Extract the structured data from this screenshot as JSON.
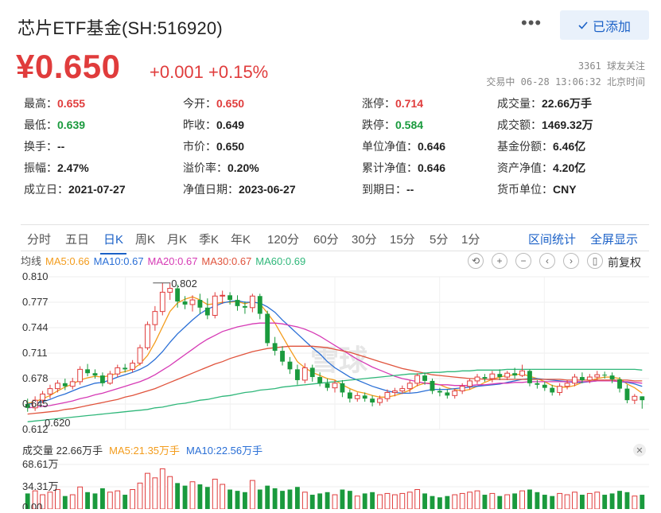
{
  "header": {
    "title": "芯片ETF基金(SH:516920)",
    "added_label": "已添加",
    "more_label": "•••"
  },
  "quote": {
    "price": "¥0.650",
    "change": "+0.001 +0.15%",
    "followers": "3361 球友关注",
    "status": "交易中 06-28 13:06:32 北京时间"
  },
  "stats": [
    [
      {
        "label": "最高：",
        "value": "0.655",
        "tone": "up"
      },
      {
        "label": "今开：",
        "value": "0.650",
        "tone": "up"
      },
      {
        "label": "涨停：",
        "value": "0.714",
        "tone": "up"
      },
      {
        "label": "成交量：",
        "value": "22.66万手",
        "tone": ""
      }
    ],
    [
      {
        "label": "最低：",
        "value": "0.639",
        "tone": "down"
      },
      {
        "label": "昨收：",
        "value": "0.649",
        "tone": ""
      },
      {
        "label": "跌停：",
        "value": "0.584",
        "tone": "down"
      },
      {
        "label": "成交额：",
        "value": "1469.32万",
        "tone": ""
      }
    ],
    [
      {
        "label": "换手：",
        "value": "--",
        "tone": ""
      },
      {
        "label": "市价：",
        "value": "0.650",
        "tone": ""
      },
      {
        "label": "单位净值：",
        "value": "0.646",
        "tone": ""
      },
      {
        "label": "基金份额：",
        "value": "6.46亿",
        "tone": ""
      }
    ],
    [
      {
        "label": "振幅：",
        "value": "2.47%",
        "tone": ""
      },
      {
        "label": "溢价率：",
        "value": "0.20%",
        "tone": ""
      },
      {
        "label": "累计净值：",
        "value": "0.646",
        "tone": ""
      },
      {
        "label": "资产净值：",
        "value": "4.20亿",
        "tone": ""
      }
    ],
    [
      {
        "label": "成立日：",
        "value": "2021-07-27",
        "tone": ""
      },
      {
        "label": "净值日期：",
        "value": "2023-06-27",
        "tone": ""
      },
      {
        "label": "到期日：",
        "value": "--",
        "tone": ""
      },
      {
        "label": "货币单位：",
        "value": "CNY",
        "tone": ""
      }
    ]
  ],
  "tabs": [
    "分时",
    "五日",
    "日K",
    "周K",
    "月K",
    "季K",
    "年K",
    "120分",
    "60分",
    "30分",
    "15分",
    "5分",
    "1分"
  ],
  "active_tab": "日K",
  "tab_links": [
    "区间统计",
    "全屏显示"
  ],
  "ma_legend": [
    {
      "label": "均线",
      "color": "#555555"
    },
    {
      "label": "MA5:0.66",
      "color": "#f39c1c"
    },
    {
      "label": "MA10:0.67",
      "color": "#2a6fd6"
    },
    {
      "label": "MA20:0.67",
      "color": "#d63ab5"
    },
    {
      "label": "MA30:0.67",
      "color": "#e0533c"
    },
    {
      "label": "MA60:0.69",
      "color": "#2fb77a"
    }
  ],
  "tool_icons": [
    "reset-icon",
    "zoom-in-icon",
    "zoom-out-icon",
    "pan-left-icon",
    "pan-right-icon",
    "candle-icon"
  ],
  "rehab_label": "前复权",
  "volume_legend": [
    {
      "label": "成交量 22.66万手",
      "color": "#333333"
    },
    {
      "label": "MA5:21.35万手",
      "color": "#f39c1c"
    },
    {
      "label": "MA10:22.56万手",
      "color": "#2a6fd6"
    }
  ],
  "watermark": "雪球",
  "colors": {
    "up": "#e03c3c",
    "down": "#1a9a3d",
    "accent": "#1b61c7"
  },
  "chart_data": {
    "type": "candlestick",
    "price_axis": {
      "ticks": [
        "0.810",
        "0.777",
        "0.744",
        "0.711",
        "0.678",
        "0.645",
        "0.612"
      ],
      "range": [
        0.612,
        0.81
      ]
    },
    "annotations": [
      {
        "label": "0.802"
      },
      {
        "label": "0.620"
      }
    ],
    "volume_axis": {
      "ticks": [
        "68.61万",
        "34.31万",
        "0.00"
      ],
      "range": [
        0,
        68.61
      ]
    },
    "candles": [
      [
        0.645,
        0.64,
        0.652,
        0.635
      ],
      [
        0.64,
        0.65,
        0.655,
        0.636
      ],
      [
        0.65,
        0.658,
        0.662,
        0.646
      ],
      [
        0.658,
        0.665,
        0.67,
        0.652
      ],
      [
        0.665,
        0.672,
        0.676,
        0.66
      ],
      [
        0.672,
        0.668,
        0.678,
        0.663
      ],
      [
        0.668,
        0.674,
        0.679,
        0.664
      ],
      [
        0.674,
        0.69,
        0.694,
        0.67
      ],
      [
        0.69,
        0.685,
        0.697,
        0.681
      ],
      [
        0.685,
        0.682,
        0.69,
        0.678
      ],
      [
        0.682,
        0.672,
        0.686,
        0.668
      ],
      [
        0.672,
        0.684,
        0.688,
        0.67
      ],
      [
        0.684,
        0.692,
        0.696,
        0.68
      ],
      [
        0.692,
        0.69,
        0.697,
        0.686
      ],
      [
        0.69,
        0.698,
        0.702,
        0.686
      ],
      [
        0.698,
        0.718,
        0.722,
        0.695
      ],
      [
        0.718,
        0.748,
        0.752,
        0.715
      ],
      [
        0.748,
        0.765,
        0.772,
        0.74
      ],
      [
        0.765,
        0.79,
        0.802,
        0.76
      ],
      [
        0.79,
        0.795,
        0.802,
        0.78
      ],
      [
        0.795,
        0.778,
        0.8,
        0.77
      ],
      [
        0.778,
        0.774,
        0.785,
        0.768
      ],
      [
        0.774,
        0.78,
        0.786,
        0.765
      ],
      [
        0.78,
        0.77,
        0.788,
        0.762
      ],
      [
        0.77,
        0.76,
        0.782,
        0.755
      ],
      [
        0.76,
        0.785,
        0.79,
        0.756
      ],
      [
        0.785,
        0.786,
        0.792,
        0.775
      ],
      [
        0.786,
        0.78,
        0.79,
        0.774
      ],
      [
        0.78,
        0.772,
        0.786,
        0.766
      ],
      [
        0.772,
        0.77,
        0.778,
        0.762
      ],
      [
        0.77,
        0.785,
        0.788,
        0.764
      ],
      [
        0.785,
        0.762,
        0.788,
        0.755
      ],
      [
        0.762,
        0.724,
        0.766,
        0.72
      ],
      [
        0.724,
        0.714,
        0.732,
        0.708
      ],
      [
        0.714,
        0.7,
        0.72,
        0.695
      ],
      [
        0.7,
        0.69,
        0.706,
        0.684
      ],
      [
        0.69,
        0.676,
        0.696,
        0.67
      ],
      [
        0.676,
        0.692,
        0.698,
        0.672
      ],
      [
        0.692,
        0.68,
        0.696,
        0.674
      ],
      [
        0.68,
        0.672,
        0.686,
        0.668
      ],
      [
        0.672,
        0.666,
        0.678,
        0.662
      ],
      [
        0.666,
        0.672,
        0.676,
        0.66
      ],
      [
        0.672,
        0.66,
        0.676,
        0.654
      ],
      [
        0.66,
        0.652,
        0.664,
        0.647
      ],
      [
        0.652,
        0.656,
        0.66,
        0.648
      ],
      [
        0.656,
        0.652,
        0.66,
        0.648
      ],
      [
        0.652,
        0.647,
        0.656,
        0.642
      ],
      [
        0.647,
        0.652,
        0.656,
        0.643
      ],
      [
        0.652,
        0.66,
        0.664,
        0.648
      ],
      [
        0.66,
        0.662,
        0.666,
        0.655
      ],
      [
        0.662,
        0.665,
        0.669,
        0.658
      ],
      [
        0.665,
        0.672,
        0.676,
        0.66
      ],
      [
        0.672,
        0.682,
        0.685,
        0.668
      ],
      [
        0.682,
        0.675,
        0.686,
        0.67
      ],
      [
        0.675,
        0.662,
        0.678,
        0.658
      ],
      [
        0.662,
        0.66,
        0.666,
        0.655
      ],
      [
        0.66,
        0.656,
        0.664,
        0.652
      ],
      [
        0.656,
        0.662,
        0.665,
        0.652
      ],
      [
        0.662,
        0.668,
        0.672,
        0.658
      ],
      [
        0.668,
        0.675,
        0.678,
        0.664
      ],
      [
        0.675,
        0.68,
        0.684,
        0.671
      ],
      [
        0.68,
        0.678,
        0.684,
        0.674
      ],
      [
        0.678,
        0.684,
        0.688,
        0.673
      ],
      [
        0.684,
        0.68,
        0.69,
        0.676
      ],
      [
        0.68,
        0.685,
        0.688,
        0.676
      ],
      [
        0.685,
        0.682,
        0.692,
        0.678
      ],
      [
        0.682,
        0.688,
        0.696,
        0.68
      ],
      [
        0.688,
        0.672,
        0.69,
        0.668
      ],
      [
        0.672,
        0.67,
        0.676,
        0.665
      ],
      [
        0.67,
        0.666,
        0.674,
        0.662
      ],
      [
        0.666,
        0.66,
        0.67,
        0.656
      ],
      [
        0.66,
        0.668,
        0.672,
        0.656
      ],
      [
        0.668,
        0.672,
        0.676,
        0.664
      ],
      [
        0.672,
        0.68,
        0.684,
        0.668
      ],
      [
        0.68,
        0.676,
        0.686,
        0.672
      ],
      [
        0.676,
        0.68,
        0.684,
        0.672
      ],
      [
        0.68,
        0.683,
        0.688,
        0.676
      ],
      [
        0.683,
        0.682,
        0.687,
        0.678
      ],
      [
        0.682,
        0.677,
        0.686,
        0.672
      ],
      [
        0.677,
        0.665,
        0.68,
        0.66
      ],
      [
        0.665,
        0.65,
        0.67,
        0.646
      ],
      [
        0.65,
        0.655,
        0.658,
        0.645
      ],
      [
        0.655,
        0.65,
        0.655,
        0.639
      ]
    ],
    "volume": [
      24,
      28,
      22,
      26,
      30,
      20,
      22,
      34,
      26,
      24,
      32,
      26,
      28,
      22,
      30,
      40,
      55,
      48,
      62,
      50,
      40,
      36,
      42,
      38,
      34,
      46,
      38,
      30,
      28,
      26,
      44,
      30,
      36,
      32,
      28,
      30,
      34,
      26,
      22,
      24,
      26,
      22,
      30,
      28,
      20,
      24,
      26,
      22,
      24,
      22,
      24,
      26,
      30,
      24,
      20,
      18,
      20,
      22,
      24,
      26,
      28,
      22,
      24,
      20,
      22,
      24,
      28,
      30,
      26,
      22,
      20,
      24,
      22,
      26,
      22,
      24,
      26,
      22,
      24,
      28,
      26,
      20,
      22
    ],
    "ma": {
      "MA5": [
        0.646,
        0.648,
        0.652,
        0.656,
        0.662,
        0.667,
        0.671,
        0.676,
        0.679,
        0.681,
        0.68,
        0.682,
        0.685,
        0.687,
        0.69,
        0.697,
        0.708,
        0.725,
        0.745,
        0.765,
        0.776,
        0.781,
        0.784,
        0.78,
        0.774,
        0.775,
        0.777,
        0.777,
        0.778,
        0.775,
        0.778,
        0.775,
        0.763,
        0.75,
        0.733,
        0.716,
        0.7,
        0.692,
        0.686,
        0.682,
        0.678,
        0.676,
        0.67,
        0.665,
        0.661,
        0.659,
        0.656,
        0.654,
        0.654,
        0.656,
        0.659,
        0.663,
        0.669,
        0.672,
        0.672,
        0.67,
        0.666,
        0.664,
        0.662,
        0.664,
        0.668,
        0.673,
        0.677,
        0.68,
        0.682,
        0.683,
        0.684,
        0.681,
        0.678,
        0.674,
        0.669,
        0.667,
        0.667,
        0.669,
        0.673,
        0.675,
        0.678,
        0.68,
        0.68,
        0.678,
        0.671,
        0.666,
        0.659
      ],
      "MA10": [
        0.645,
        0.646,
        0.648,
        0.651,
        0.655,
        0.658,
        0.662,
        0.666,
        0.669,
        0.672,
        0.673,
        0.676,
        0.68,
        0.683,
        0.686,
        0.69,
        0.695,
        0.703,
        0.713,
        0.725,
        0.736,
        0.745,
        0.754,
        0.762,
        0.768,
        0.772,
        0.776,
        0.778,
        0.779,
        0.777,
        0.777,
        0.776,
        0.771,
        0.764,
        0.754,
        0.745,
        0.736,
        0.727,
        0.718,
        0.71,
        0.7,
        0.692,
        0.686,
        0.68,
        0.676,
        0.672,
        0.668,
        0.665,
        0.662,
        0.66,
        0.659,
        0.659,
        0.66,
        0.662,
        0.664,
        0.664,
        0.664,
        0.665,
        0.666,
        0.667,
        0.668,
        0.669,
        0.67,
        0.671,
        0.673,
        0.675,
        0.677,
        0.678,
        0.678,
        0.677,
        0.676,
        0.675,
        0.674,
        0.673,
        0.673,
        0.674,
        0.675,
        0.675,
        0.675,
        0.674,
        0.673,
        0.671,
        0.668
      ],
      "MA20": [
        0.64,
        0.641,
        0.642,
        0.643,
        0.645,
        0.647,
        0.649,
        0.652,
        0.654,
        0.657,
        0.659,
        0.662,
        0.665,
        0.668,
        0.671,
        0.674,
        0.678,
        0.683,
        0.689,
        0.695,
        0.702,
        0.709,
        0.716,
        0.723,
        0.729,
        0.734,
        0.739,
        0.742,
        0.745,
        0.747,
        0.749,
        0.75,
        0.75,
        0.75,
        0.749,
        0.747,
        0.745,
        0.742,
        0.738,
        0.733,
        0.727,
        0.721,
        0.715,
        0.709,
        0.703,
        0.698,
        0.693,
        0.689,
        0.685,
        0.681,
        0.678,
        0.676,
        0.674,
        0.672,
        0.671,
        0.67,
        0.67,
        0.669,
        0.669,
        0.669,
        0.67,
        0.67,
        0.671,
        0.672,
        0.672,
        0.673,
        0.673,
        0.674,
        0.674,
        0.674,
        0.674,
        0.674,
        0.674,
        0.674,
        0.674,
        0.674,
        0.675,
        0.675,
        0.675,
        0.674,
        0.674,
        0.673,
        0.672
      ],
      "MA30": [
        0.632,
        0.633,
        0.634,
        0.635,
        0.636,
        0.638,
        0.639,
        0.641,
        0.643,
        0.645,
        0.647,
        0.649,
        0.651,
        0.654,
        0.656,
        0.659,
        0.662,
        0.665,
        0.669,
        0.673,
        0.677,
        0.681,
        0.685,
        0.689,
        0.693,
        0.697,
        0.7,
        0.704,
        0.707,
        0.71,
        0.713,
        0.715,
        0.717,
        0.718,
        0.719,
        0.72,
        0.72,
        0.72,
        0.72,
        0.719,
        0.718,
        0.716,
        0.714,
        0.712,
        0.709,
        0.706,
        0.703,
        0.7,
        0.697,
        0.694,
        0.691,
        0.689,
        0.687,
        0.685,
        0.683,
        0.682,
        0.681,
        0.68,
        0.679,
        0.678,
        0.678,
        0.677,
        0.677,
        0.677,
        0.677,
        0.677,
        0.677,
        0.677,
        0.677,
        0.677,
        0.677,
        0.677,
        0.676,
        0.676,
        0.676,
        0.676,
        0.676,
        0.676,
        0.676,
        0.676,
        0.676,
        0.675,
        0.675
      ],
      "MA60": [
        0.622,
        0.623,
        0.624,
        0.625,
        0.626,
        0.627,
        0.628,
        0.629,
        0.63,
        0.631,
        0.632,
        0.633,
        0.634,
        0.635,
        0.636,
        0.637,
        0.638,
        0.64,
        0.641,
        0.643,
        0.645,
        0.646,
        0.648,
        0.65,
        0.651,
        0.653,
        0.655,
        0.656,
        0.658,
        0.66,
        0.661,
        0.663,
        0.664,
        0.665,
        0.667,
        0.668,
        0.669,
        0.67,
        0.671,
        0.672,
        0.673,
        0.674,
        0.675,
        0.676,
        0.677,
        0.678,
        0.679,
        0.68,
        0.681,
        0.682,
        0.683,
        0.684,
        0.684,
        0.685,
        0.686,
        0.686,
        0.687,
        0.687,
        0.688,
        0.688,
        0.689,
        0.689,
        0.689,
        0.689,
        0.69,
        0.69,
        0.69,
        0.69,
        0.69,
        0.69,
        0.69,
        0.69,
        0.69,
        0.69,
        0.69,
        0.69,
        0.69,
        0.69,
        0.69,
        0.69,
        0.69,
        0.69,
        0.689
      ]
    }
  }
}
